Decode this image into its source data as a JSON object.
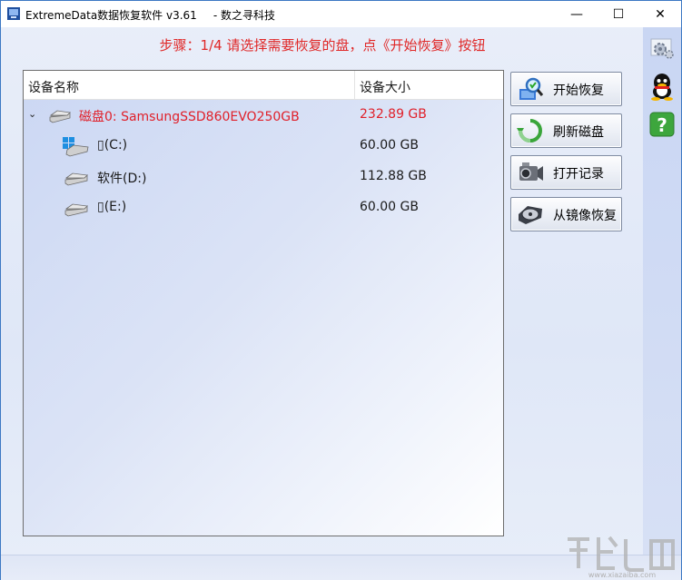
{
  "window": {
    "title": "ExtremeData数据恢复软件 v3.61",
    "subtitle": "- 数之寻科技",
    "minimize_glyph": "—",
    "maximize_glyph": "☐",
    "close_glyph": "✕"
  },
  "step_text": "步骤：1/4 请选择需要恢复的盘，点《开始恢复》按钮",
  "device_list": {
    "columns": [
      "设备名称",
      "设备大小"
    ],
    "rows": [
      {
        "type": "disk",
        "expander": "⌄",
        "name": "磁盘0: SamsungSSD860EVO250GB",
        "size": "232.89 GB",
        "icon": "hard-disk-icon"
      },
      {
        "type": "partition",
        "name": "▯(C:)",
        "size": "60.00 GB",
        "icon": "windows-drive-icon"
      },
      {
        "type": "partition",
        "name": "软件(D:)",
        "size": "112.88 GB",
        "icon": "drive-icon"
      },
      {
        "type": "partition",
        "name": "▯(E:)",
        "size": "60.00 GB",
        "icon": "drive-icon"
      }
    ]
  },
  "buttons": [
    {
      "label": "开始恢复",
      "icon": "magnifier-icon"
    },
    {
      "label": "刷新磁盘",
      "icon": "refresh-icon"
    },
    {
      "label": "打开记录",
      "icon": "camera-icon"
    },
    {
      "label": "从镜像恢复",
      "icon": "disk-image-icon"
    }
  ],
  "sidebar": [
    {
      "icon": "settings-icon"
    },
    {
      "icon": "qq-icon"
    },
    {
      "icon": "help-icon"
    }
  ],
  "status": {
    "text": ""
  },
  "colors": {
    "accent": "#e02828",
    "border": "#3c78c3",
    "sidebar": "#c9d6f3"
  }
}
